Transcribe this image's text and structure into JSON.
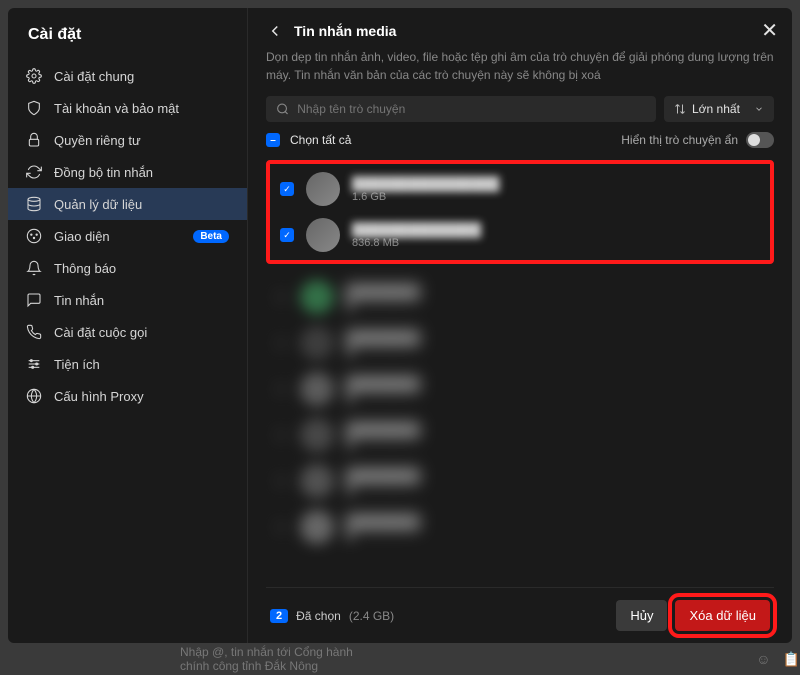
{
  "dialog": {
    "title": "Cài đặt",
    "sidebar": [
      {
        "id": "caidatchung",
        "label": "Cài đặt chung",
        "icon": "gear"
      },
      {
        "id": "taikhoan",
        "label": "Tài khoản và bảo mật",
        "icon": "shield"
      },
      {
        "id": "quyen",
        "label": "Quyền riêng tư",
        "icon": "lock"
      },
      {
        "id": "dongbo",
        "label": "Đồng bộ tin nhắn",
        "icon": "sync"
      },
      {
        "id": "quanly",
        "label": "Quản lý dữ liệu",
        "icon": "database",
        "active": true
      },
      {
        "id": "giaodien",
        "label": "Giao diện",
        "icon": "palette",
        "badge": "Beta"
      },
      {
        "id": "thongbao",
        "label": "Thông báo",
        "icon": "bell"
      },
      {
        "id": "tinnhan",
        "label": "Tin nhắn",
        "icon": "message"
      },
      {
        "id": "cuocgoi",
        "label": "Cài đặt cuộc gọi",
        "icon": "phone"
      },
      {
        "id": "tienich",
        "label": "Tiện ích",
        "icon": "utility"
      },
      {
        "id": "proxy",
        "label": "Cấu hình Proxy",
        "icon": "proxy"
      }
    ]
  },
  "main": {
    "title": "Tin nhắn media",
    "description": "Dọn dẹp tin nhắn ảnh, video, file hoặc tệp ghi âm của trò chuyện để giải phóng dung lượng trên máy. Tin nhắn văn bản của các trò chuyện này sẽ không bị xoá",
    "search_placeholder": "Nhập tên trò chuyện",
    "sort_label": "Lớn nhất",
    "select_all": "Chọn tất cả",
    "hidden_toggle": "Hiển thị trò chuyện ẩn"
  },
  "conversations": {
    "top_checked": [
      {
        "size": "1.6 GB"
      },
      {
        "size": "836.8 MB"
      }
    ]
  },
  "footer": {
    "count": "2",
    "selected_label": "Đã chọn",
    "total_size": "(2.4 GB)",
    "cancel": "Hủy",
    "delete": "Xóa dữ liệu"
  },
  "chat_placeholder": "Nhập @, tin nhắn tới Cổng hành chính công tỉnh Đắk Nông"
}
